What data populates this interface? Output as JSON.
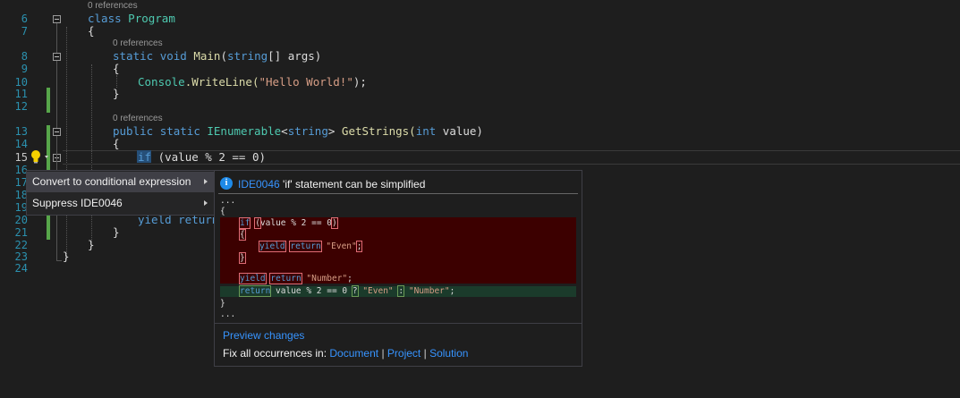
{
  "editor": {
    "line_numbers": [
      "6",
      "7",
      "8",
      "9",
      "10",
      "11",
      "12",
      "13",
      "14",
      "15",
      "16",
      "17",
      "18",
      "19",
      "20",
      "21",
      "22",
      "23",
      "24"
    ],
    "refs": [
      "0 references",
      "0 references",
      "0 references"
    ],
    "class_kw": "class",
    "class_name": "Program",
    "open_brace": "{",
    "close_brace": "}",
    "static_kw": "static",
    "void_kw": "void",
    "main_name": "Main",
    "string_kw": "string",
    "args_text": "[] args)",
    "open_paren": "(",
    "console_type": "Console",
    "writeline_text": ".WriteLine(",
    "hello_str": "\"Hello World!\"",
    "stmt_end": ");",
    "public_kw": "public",
    "ienumerable_type": "IEnumerable",
    "generic_open": "<",
    "generic_close": ">",
    "getstrings_name": " GetStrings(",
    "int_kw": "int",
    "value_param": " value)",
    "if_kw": "if",
    "if_cond": " (value % 2 == 0)",
    "yield_return": "yield return"
  },
  "lightbulb": {
    "icon": "lightbulb-icon",
    "color": "#f5d000"
  },
  "quick_actions": {
    "items": [
      {
        "label": "Convert to conditional expression"
      },
      {
        "label": "Suppress IDE0046"
      }
    ]
  },
  "preview": {
    "diag_id": "IDE0046",
    "diag_message": "'if' statement can be simplified",
    "code": {
      "ellipsis": "...",
      "open_brace": "{",
      "close_brace": "}",
      "if_kw": "if",
      "cond_open": "(",
      "cond_mid": "value % 2 == 0",
      "cond_close": ")",
      "inner_open": "{",
      "inner_close": "}",
      "yield_kw": "yield",
      "return_kw": "return",
      "even_str": "\"Even\"",
      "semicolon": ";",
      "number_str": "\"Number\"",
      "new_return": "return",
      "new_expr": " value % 2 == 0 ",
      "question": "?",
      "colon": ":"
    },
    "preview_changes": "Preview changes",
    "fix_all_label": "Fix all occurrences in:",
    "scopes": [
      "Document",
      "Project",
      "Solution"
    ],
    "separator": "|"
  },
  "colors": {
    "removed_bg": "#3c0000",
    "added_bg": "#1b3b2b",
    "info_icon": "#1e8ae8",
    "change_bar": "#57a64a"
  }
}
